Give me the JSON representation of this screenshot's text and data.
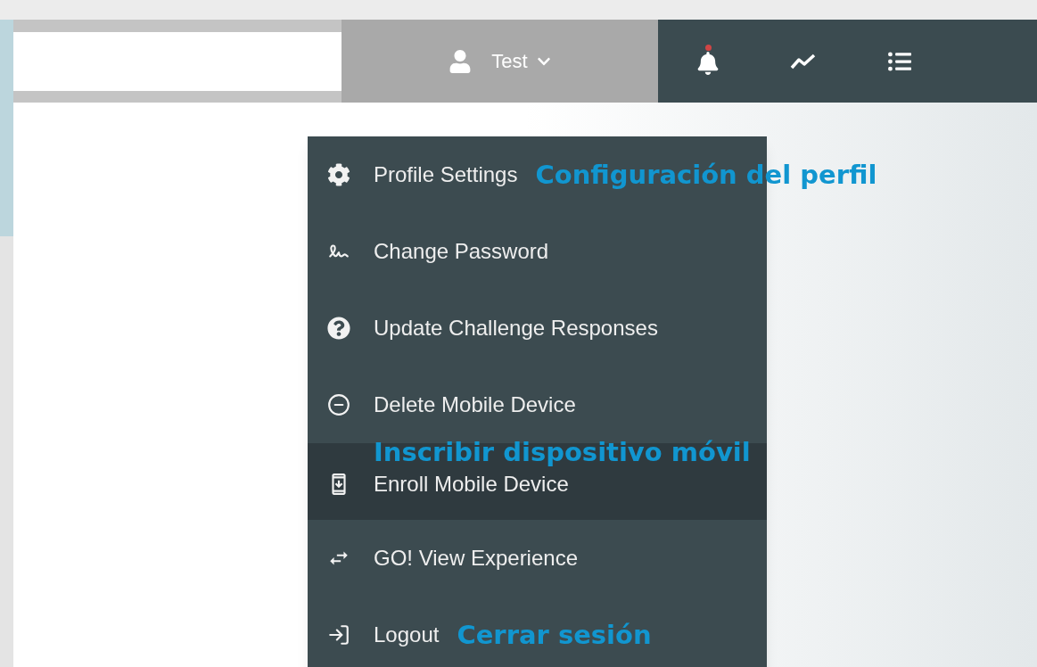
{
  "header": {
    "user_menu": {
      "label": "Test",
      "expanded": true
    }
  },
  "menu": {
    "items": [
      {
        "label": "Profile Settings",
        "hovered": false,
        "annotation": "Configuración del perfil"
      },
      {
        "label": "Change Password",
        "hovered": false
      },
      {
        "label": "Update Challenge Responses",
        "hovered": false
      },
      {
        "label": "Delete Mobile Device",
        "hovered": false
      },
      {
        "label": "Enroll Mobile Device",
        "hovered": true,
        "annotation": "Inscribir  dispositivo móvil"
      },
      {
        "label": "GO! View Experience",
        "hovered": false
      },
      {
        "label": "Logout",
        "hovered": false,
        "annotation": "Cerrar sesión"
      }
    ]
  }
}
